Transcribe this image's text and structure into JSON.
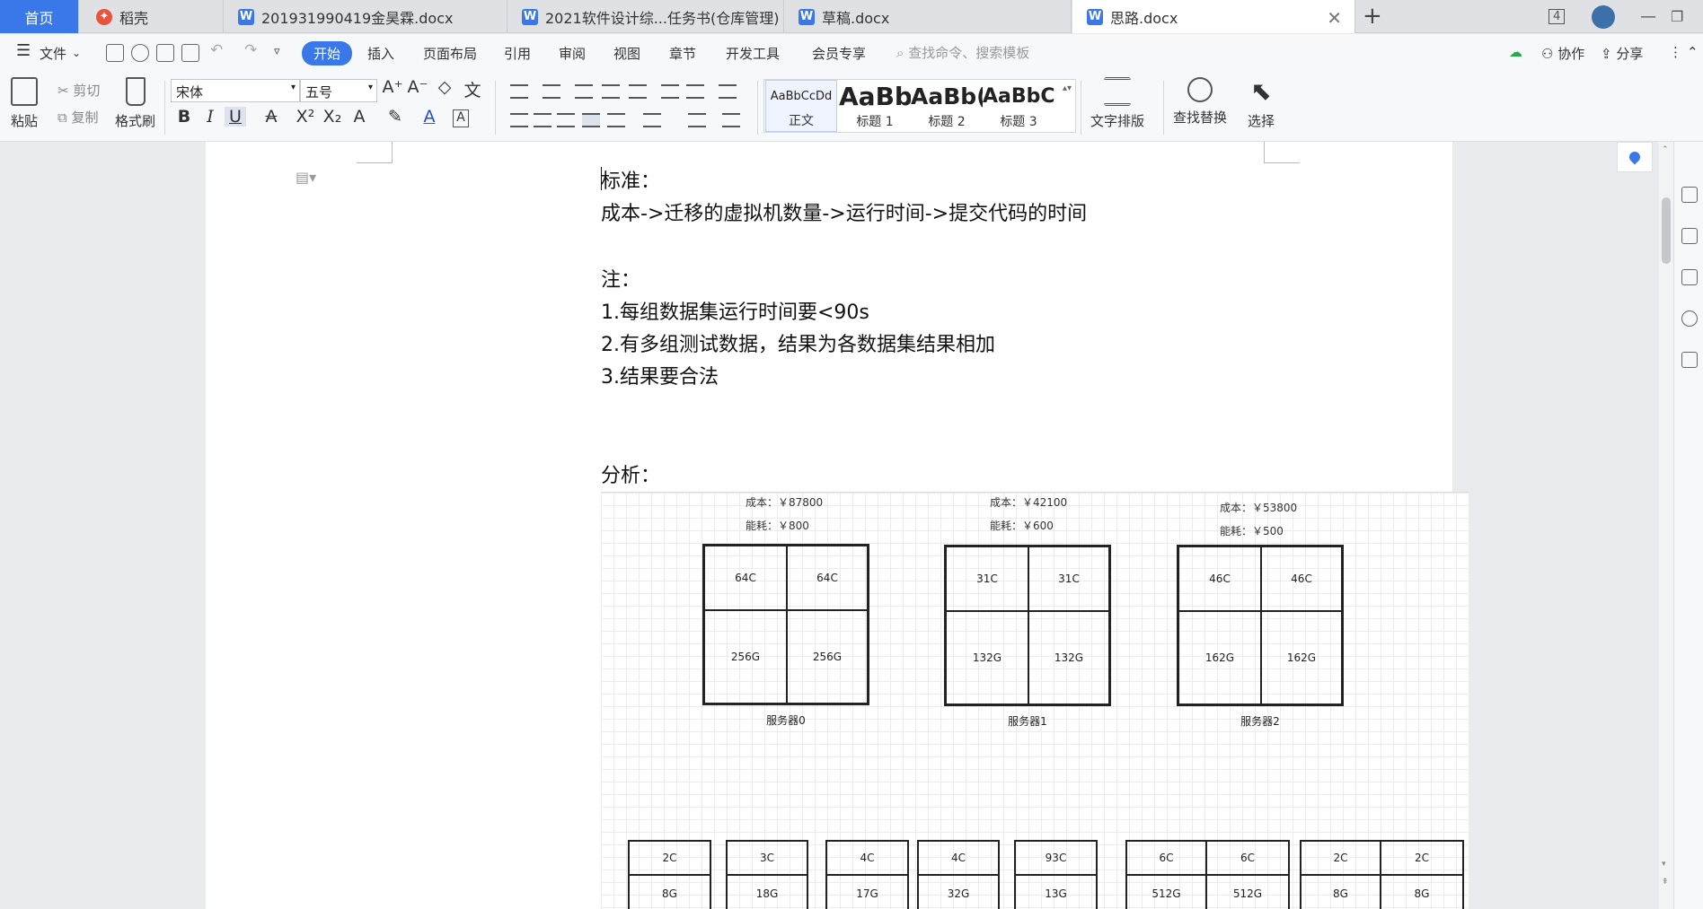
{
  "tabs": {
    "home": "首页",
    "daoke": "稻壳",
    "doc1": "201931990419金昊霖.docx",
    "doc2": "2021软件设计综...任务书(仓库管理)",
    "doc3": "草稿.docx",
    "doc4": "思路.docx",
    "window_count": "4"
  },
  "menu": {
    "file": "文件",
    "start": "开始",
    "insert": "插入",
    "layout": "页面布局",
    "reference": "引用",
    "review": "审阅",
    "view": "视图",
    "chapter": "章节",
    "devtools": "开发工具",
    "member": "会员专享",
    "search_placeholder": "查找命令、搜索模板",
    "collab": "协作",
    "share": "分享"
  },
  "ribbon": {
    "paste": "粘贴",
    "cut": "剪切",
    "copy": "复制",
    "format_painter": "格式刷",
    "font_name": "宋体",
    "font_size": "五号",
    "styles": [
      {
        "sample": "AaBbCcDd",
        "name": "正文"
      },
      {
        "sample": "AaBb",
        "name": "标题 1"
      },
      {
        "sample": "AaBb(",
        "name": "标题 2"
      },
      {
        "sample": "AaBbC",
        "name": "标题 3"
      }
    ],
    "text_layout": "文字排版",
    "find_replace": "查找替换",
    "select": "选择"
  },
  "document": {
    "line1": "标准：",
    "line2": "成本->迁移的虚拟机数量->运行时间->提交代码的时间",
    "note_title": "注：",
    "note1": "1.每组数据集运行时间要<90s",
    "note2": "2.有多组测试数据，结果为各数据集结果相加",
    "note3": "3.结果要合法",
    "analysis": "分析："
  },
  "diagram": {
    "servers": [
      {
        "cost": "成本：￥87800",
        "power": "能耗：￥800",
        "cpu": "64C",
        "mem": "256G",
        "name": "服务器0"
      },
      {
        "cost": "成本：￥42100",
        "power": "能耗：￥600",
        "cpu": "31C",
        "mem": "132G",
        "name": "服务器1"
      },
      {
        "cost": "成本：￥53800",
        "power": "能耗：￥500",
        "cpu": "46C",
        "mem": "162G",
        "name": "服务器2"
      }
    ],
    "vms": [
      {
        "cpu": "2C",
        "mem": "8G"
      },
      {
        "cpu": "3C",
        "mem": "18G"
      },
      {
        "cpu": "4C",
        "mem": "17G"
      },
      {
        "cpu": "4C",
        "mem": "32G"
      },
      {
        "cpu": "93C",
        "mem": "13G"
      },
      {
        "cpu": "6C",
        "mem": "512G"
      },
      {
        "cpu": "6C",
        "mem": "512G"
      },
      {
        "cpu": "2C",
        "mem": "8G"
      },
      {
        "cpu": "2C",
        "mem": "8G"
      }
    ]
  },
  "colors": {
    "accent": "#3a77e9",
    "wps_red": "#e8533b"
  }
}
